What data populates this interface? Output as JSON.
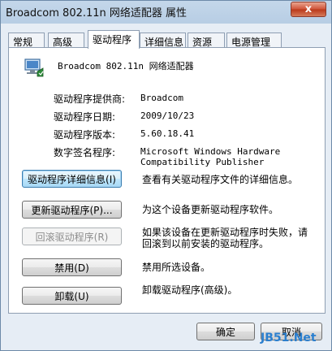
{
  "window": {
    "title": "Broadcom 802.11n 网络适配器 属性",
    "close_label": "x"
  },
  "tabs": [
    {
      "label": "常规"
    },
    {
      "label": "高级"
    },
    {
      "label": "驱动程序",
      "active": true
    },
    {
      "label": "详细信息"
    },
    {
      "label": "资源"
    },
    {
      "label": "电源管理"
    }
  ],
  "device": {
    "icon": "network-adapter-icon",
    "name": "Broadcom 802.11n 网络适配器"
  },
  "info": [
    {
      "label": "驱动程序提供商:",
      "value": "Broadcom"
    },
    {
      "label": "驱动程序日期:",
      "value": "2009/10/23"
    },
    {
      "label": "驱动程序版本:",
      "value": "5.60.18.41"
    },
    {
      "label": "数字签名程序:",
      "value": "Microsoft Windows Hardware",
      "value2": "Compatibility Publisher"
    }
  ],
  "actions": [
    {
      "button": "驱动程序详细信息(I)",
      "desc": "查看有关驱动程序文件的详细信息。"
    },
    {
      "button": "更新驱动程序(P)...",
      "desc": "为这个设备更新驱动程序软件。"
    },
    {
      "button": "回滚驱动程序(R)",
      "desc": "如果该设备在更新驱动程序时失败，请",
      "desc2": "回滚到以前安装的驱动程序。"
    },
    {
      "button": "禁用(D)",
      "desc": "禁用所选设备。"
    },
    {
      "button": "卸载(U)",
      "desc": "卸载驱动程序(高级)。"
    }
  ],
  "footer": {
    "ok": "确定",
    "cancel": "取消"
  },
  "watermark": {
    "a": "JB51",
    "b": ".Net"
  },
  "colors": {
    "accent": "#3c7fb1",
    "close": "#cf5136"
  }
}
